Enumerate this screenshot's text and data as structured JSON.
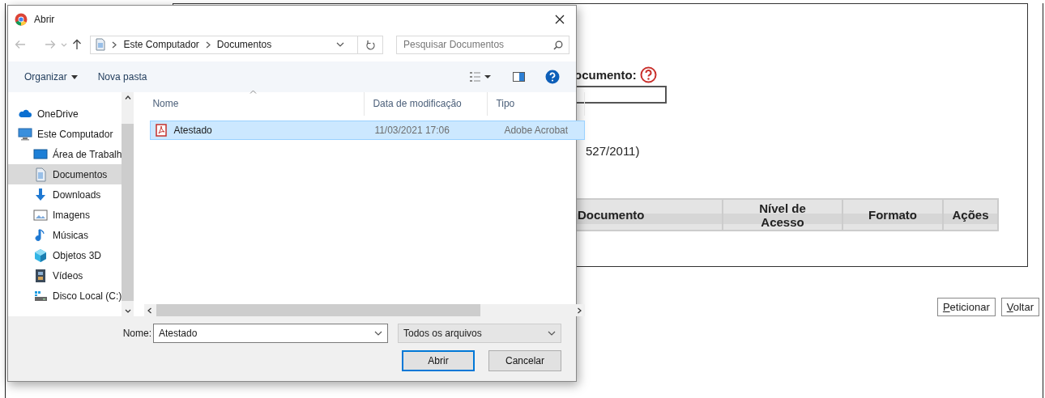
{
  "page": {
    "field_label": "ocumento:",
    "note": "527/2011)",
    "table": {
      "columns": [
        "Documento",
        "Nível de Acesso",
        "Formato",
        "Ações"
      ]
    },
    "buttons": [
      "Peticionar",
      "Voltar"
    ]
  },
  "dialog": {
    "title": "Abrir",
    "breadcrumb": [
      "Este Computador",
      "Documentos"
    ],
    "search": {
      "placeholder": "Pesquisar Documentos"
    },
    "toolbar": [
      {
        "label": "Organizar",
        "kind": "menu"
      },
      {
        "label": "Nova pasta",
        "kind": "plain"
      }
    ],
    "sidebar": {
      "items": [
        {
          "label": "OneDrive",
          "kind": "cloud",
          "selected": false
        },
        {
          "label": "Este Computador",
          "kind": "computer",
          "selected": false,
          "children": [
            {
              "label": "Área de Trabalh",
              "kind": "desktop",
              "selected": false
            },
            {
              "label": "Documentos",
              "kind": "document",
              "selected": true
            },
            {
              "label": "Downloads",
              "kind": "download",
              "selected": false
            },
            {
              "label": "Imagens",
              "kind": "image",
              "selected": false
            },
            {
              "label": "Músicas",
              "kind": "music",
              "selected": false
            },
            {
              "label": "Objetos 3D",
              "kind": "cube",
              "selected": false
            },
            {
              "label": "Vídeos",
              "kind": "film",
              "selected": false
            },
            {
              "label": "Disco Local (C:)",
              "kind": "drive",
              "selected": false
            }
          ]
        }
      ]
    },
    "columns": [
      "Nome",
      "Data de modificação",
      "Tipo"
    ],
    "files": [
      {
        "name": "Atestado",
        "modified": "11/03/2021 17:06",
        "type": "Adobe Acrobat",
        "selected": true
      }
    ],
    "filename": {
      "label": "Nome:",
      "value": "Atestado"
    },
    "filter": "Todos os arquivos",
    "buttons": [
      {
        "label": "Abrir",
        "default": true
      },
      {
        "label": "Cancelar",
        "default": false
      }
    ]
  }
}
